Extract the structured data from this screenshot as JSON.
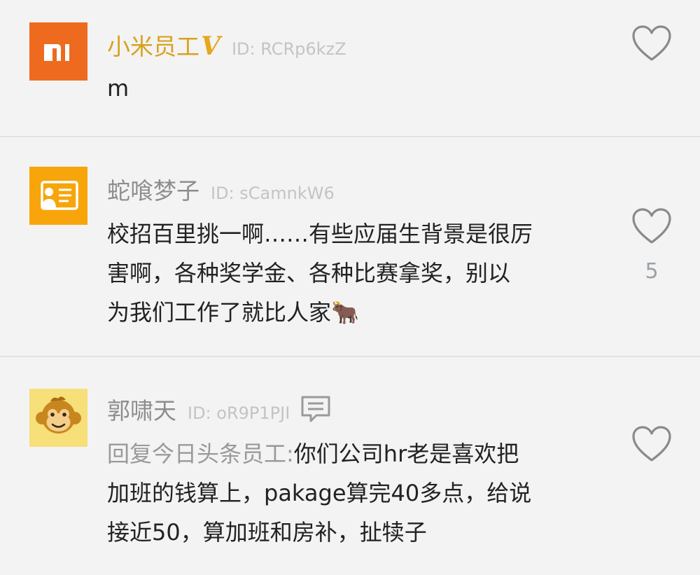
{
  "comments": [
    {
      "user": "小米员工",
      "badge": "V",
      "user_id": "ID: RCRp6kzZ",
      "avatar_icon": "mi-logo",
      "avatar_text": "mi",
      "text": "m",
      "likes": "",
      "colors": {
        "avatar_bg": "#ee6a1f",
        "name": "#d8a21e"
      }
    },
    {
      "user": "蛇喰梦子",
      "user_id": "ID: sCamnkW6",
      "avatar_icon": "id-card-icon",
      "text": "校招百里挑一啊……有些应届生背景是很厉\n害啊，各种奖学金、各种比赛拿奖，别以\n为我们工作了就比人家",
      "emoji": "🐂",
      "likes": "5",
      "colors": {
        "avatar_bg": "#f7a50a"
      }
    },
    {
      "user": "郭啸天",
      "user_id": "ID: oR9P1PJI",
      "avatar_icon": "monkey-icon",
      "has_chat_icon": true,
      "reply_prefix": "回复今日头条员工:",
      "text": "你们公司hr老是喜欢把\n加班的钱算上，pakage算完40多点，给说\n接近50，算加班和房补，扯犊子",
      "likes": "",
      "colors": {
        "avatar_bg": "#f7df7a"
      }
    }
  ]
}
